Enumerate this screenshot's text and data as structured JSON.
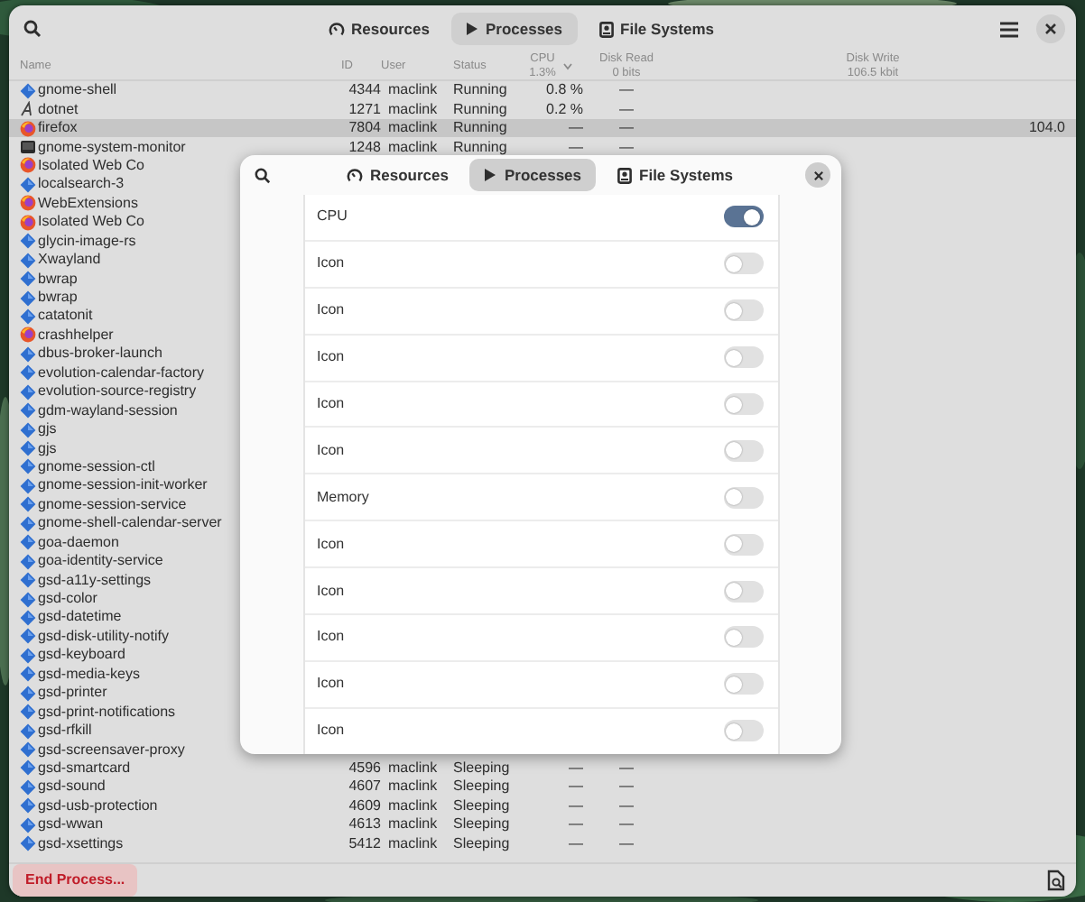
{
  "window": {
    "tabs": [
      {
        "label": "Resources",
        "selected": false
      },
      {
        "label": "Processes",
        "selected": true
      },
      {
        "label": "File Systems",
        "selected": false
      }
    ]
  },
  "table": {
    "columns": [
      {
        "label": "Name"
      },
      {
        "label": "ID"
      },
      {
        "label": "User"
      },
      {
        "label": "Status"
      },
      {
        "label": "CPU",
        "sub": "1.3%",
        "sorted": true
      },
      {
        "label": "Disk Read",
        "sub": "0 bits"
      },
      {
        "label": "Disk Write",
        "sub": "106.5 kbit"
      }
    ],
    "rows": [
      {
        "name": "gnome-shell",
        "kind": "diamond",
        "id": "4344",
        "user": "maclink",
        "status": "Running",
        "cpu": "0.8 %",
        "disk_read": "—",
        "selected": false
      },
      {
        "name": "dotnet",
        "kind": "glyph",
        "id": "1271",
        "user": "maclink",
        "status": "Running",
        "cpu": "0.2 %",
        "disk_read": "—",
        "selected": false
      },
      {
        "name": "firefox",
        "kind": "round",
        "id": "7804",
        "user": "maclink",
        "status": "Running",
        "cpu": "—",
        "disk_read": "—",
        "disk_write": "104.0",
        "selected": true
      },
      {
        "name": "gnome-system-monitor",
        "kind": "square",
        "id": "1248",
        "user": "maclink",
        "status": "Running",
        "cpu": "—",
        "disk_read": "—",
        "selected": false
      },
      {
        "name": "Isolated Web Co",
        "kind": "round",
        "selected": false
      },
      {
        "name": "localsearch-3",
        "kind": "diamond",
        "selected": false
      },
      {
        "name": "WebExtensions",
        "kind": "round",
        "selected": false
      },
      {
        "name": "Isolated Web Co",
        "kind": "round",
        "selected": false
      },
      {
        "name": "glycin-image-rs",
        "kind": "diamond",
        "selected": false
      },
      {
        "name": "Xwayland",
        "kind": "diamond",
        "selected": false
      },
      {
        "name": "bwrap",
        "kind": "diamond",
        "selected": false
      },
      {
        "name": "bwrap",
        "kind": "diamond",
        "selected": false
      },
      {
        "name": "catatonit",
        "kind": "diamond",
        "selected": false
      },
      {
        "name": "crashhelper",
        "kind": "round",
        "selected": false
      },
      {
        "name": "dbus-broker-launch",
        "kind": "diamond",
        "selected": false
      },
      {
        "name": "evolution-calendar-factory",
        "kind": "diamond",
        "selected": false
      },
      {
        "name": "evolution-source-registry",
        "kind": "diamond",
        "selected": false
      },
      {
        "name": "gdm-wayland-session",
        "kind": "diamond",
        "selected": false
      },
      {
        "name": "gjs",
        "kind": "diamond",
        "selected": false
      },
      {
        "name": "gjs",
        "kind": "diamond",
        "selected": false
      },
      {
        "name": "gnome-session-ctl",
        "kind": "diamond",
        "selected": false
      },
      {
        "name": "gnome-session-init-worker",
        "kind": "diamond",
        "selected": false
      },
      {
        "name": "gnome-session-service",
        "kind": "diamond",
        "selected": false
      },
      {
        "name": "gnome-shell-calendar-server",
        "kind": "diamond",
        "selected": false
      },
      {
        "name": "goa-daemon",
        "kind": "diamond",
        "selected": false
      },
      {
        "name": "goa-identity-service",
        "kind": "diamond",
        "selected": false
      },
      {
        "name": "gsd-a11y-settings",
        "kind": "diamond",
        "selected": false
      },
      {
        "name": "gsd-color",
        "kind": "diamond",
        "selected": false
      },
      {
        "name": "gsd-datetime",
        "kind": "diamond",
        "selected": false
      },
      {
        "name": "gsd-disk-utility-notify",
        "kind": "diamond",
        "selected": false
      },
      {
        "name": "gsd-keyboard",
        "kind": "diamond",
        "selected": false
      },
      {
        "name": "gsd-media-keys",
        "kind": "diamond",
        "selected": false
      },
      {
        "name": "gsd-printer",
        "kind": "diamond",
        "selected": false
      },
      {
        "name": "gsd-print-notifications",
        "kind": "diamond",
        "selected": false
      },
      {
        "name": "gsd-rfkill",
        "kind": "diamond",
        "selected": false
      },
      {
        "name": "gsd-screensaver-proxy",
        "kind": "diamond",
        "selected": false
      },
      {
        "name": "gsd-smartcard",
        "kind": "diamond",
        "id": "4596",
        "user": "maclink",
        "status": "Sleeping",
        "cpu": "—",
        "disk_read": "—",
        "selected": false
      },
      {
        "name": "gsd-sound",
        "kind": "diamond",
        "id": "4607",
        "user": "maclink",
        "status": "Sleeping",
        "cpu": "—",
        "disk_read": "—",
        "selected": false
      },
      {
        "name": "gsd-usb-protection",
        "kind": "diamond",
        "id": "4609",
        "user": "maclink",
        "status": "Sleeping",
        "cpu": "—",
        "disk_read": "—",
        "selected": false
      },
      {
        "name": "gsd-wwan",
        "kind": "diamond",
        "id": "4613",
        "user": "maclink",
        "status": "Sleeping",
        "cpu": "—",
        "disk_read": "—",
        "selected": false
      },
      {
        "name": "gsd-xsettings",
        "kind": "diamond",
        "id": "5412",
        "user": "maclink",
        "status": "Sleeping",
        "cpu": "—",
        "disk_read": "—",
        "selected": false
      }
    ]
  },
  "footer": {
    "end_button": "End Process..."
  },
  "dialog": {
    "tabs": [
      {
        "label": "Resources",
        "selected": false
      },
      {
        "label": "Processes",
        "selected": true
      },
      {
        "label": "File Systems",
        "selected": false
      }
    ],
    "settings": [
      {
        "label": "CPU",
        "on": true
      },
      {
        "label": "Icon",
        "on": false
      },
      {
        "label": "Icon",
        "on": false
      },
      {
        "label": "Icon",
        "on": false
      },
      {
        "label": "Icon",
        "on": false
      },
      {
        "label": "Icon",
        "on": false
      },
      {
        "label": "Memory",
        "on": false
      },
      {
        "label": "Icon",
        "on": false
      },
      {
        "label": "Icon",
        "on": false
      },
      {
        "label": "Icon",
        "on": false
      },
      {
        "label": "Icon",
        "on": false
      },
      {
        "label": "Icon",
        "on": false
      }
    ]
  }
}
